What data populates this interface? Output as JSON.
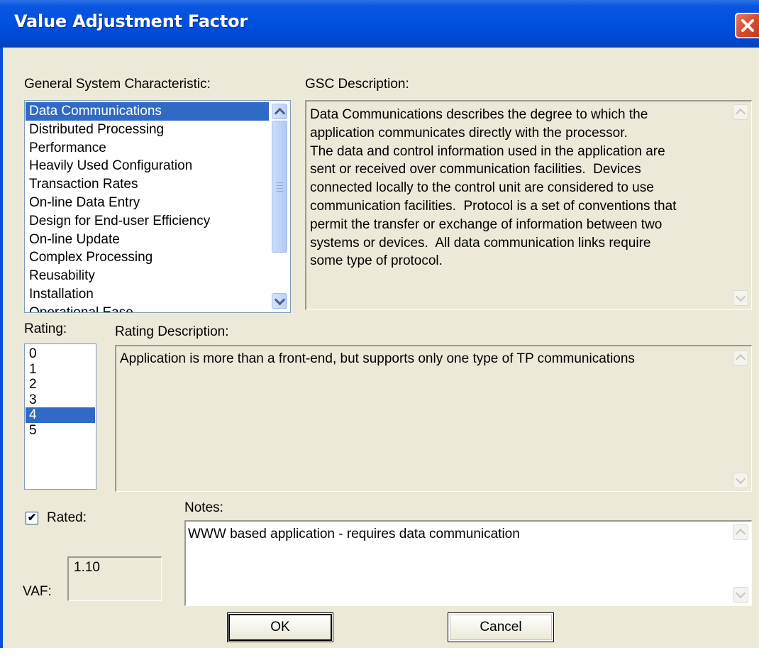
{
  "window": {
    "title": "Value Adjustment Factor"
  },
  "gsc": {
    "label": "General System Characteristic:",
    "items": [
      "Data Communications",
      "Distributed Processing",
      "Performance",
      "Heavily Used Configuration",
      "Transaction Rates",
      "On-line Data Entry",
      "Design for End-user Efficiency",
      "On-line Update",
      "Complex Processing",
      "Reusability",
      "Installation",
      "Operational Ease"
    ],
    "selected": "Data Communications"
  },
  "gsc_description": {
    "label": "GSC Description:",
    "lines": [
      "Data Communications describes the degree to which the",
      "application communicates directly with the processor.",
      "The data and control information used in the application are",
      "sent or received over communication facilities.  Devices",
      "connected locally to the control unit are considered to use",
      "communication facilities.  Protocol is a set of conventions that",
      "permit the transfer or exchange of information between two",
      "systems or devices.  All data communication links require",
      "some type of protocol."
    ]
  },
  "rating": {
    "label": "Rating:",
    "items": [
      "0",
      "1",
      "2",
      "3",
      "4",
      "5"
    ],
    "selected": "4"
  },
  "rating_description": {
    "label": "Rating Description:",
    "text": "Application is more than a front-end, but supports only one type of TP communications"
  },
  "rated": {
    "label": "Rated:",
    "checked": true,
    "check_glyph": "✔"
  },
  "vaf": {
    "label": "VAF:",
    "value": "1.10"
  },
  "notes": {
    "label": "Notes:",
    "text": "WWW based application - requires data communication"
  },
  "buttons": {
    "ok": "OK",
    "cancel": "Cancel"
  },
  "colors": {
    "titlebar": "#0050e0",
    "selection": "#316ac5",
    "dialog_bg": "#ece9d8",
    "close_button": "#d54a2b"
  }
}
